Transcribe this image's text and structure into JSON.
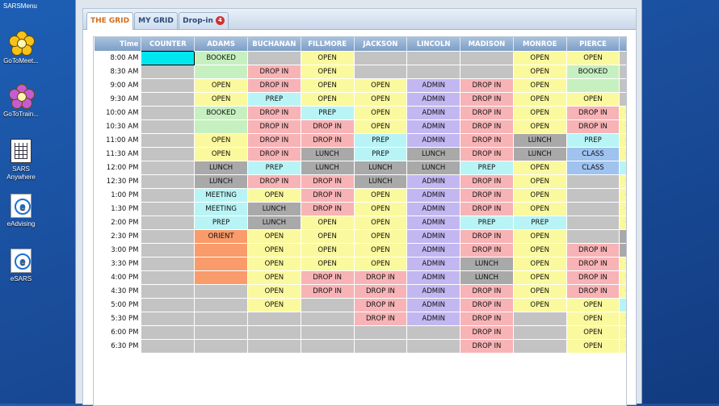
{
  "desktop": {
    "top_label": "SARSMenu",
    "icons": [
      "GoToMeet...",
      "GoToTrain...",
      "SARS Anywhere",
      "eAdvising",
      "eSARS"
    ]
  },
  "tabs": [
    {
      "label": "THE GRID",
      "active": true
    },
    {
      "label": "MY GRID",
      "active": false
    },
    {
      "label": "Drop-in",
      "active": false,
      "badge": "4"
    }
  ],
  "grid": {
    "headers": [
      "Time",
      "COUNTER",
      "ADAMS",
      "BUCHANAN",
      "FILLMORE",
      "JACKSON",
      "LINCOLN",
      "MADISON",
      "MONROE",
      "PIERCE",
      "POLI"
    ],
    "rows": [
      {
        "time": "8:00 AM",
        "cells": [
          [
            "",
            "cy"
          ],
          [
            "BOOKED",
            "gr"
          ],
          [
            "",
            "g"
          ],
          [
            "OPEN",
            "y"
          ],
          [
            "",
            "g"
          ],
          [
            "",
            "g"
          ],
          [
            "",
            "g"
          ],
          [
            "OPEN",
            "y"
          ],
          [
            "OPEN",
            "y"
          ],
          [
            "",
            "g"
          ]
        ]
      },
      {
        "time": "8:30 AM",
        "cells": [
          [
            "",
            "g"
          ],
          [
            "",
            "gr"
          ],
          [
            "DROP IN",
            "r"
          ],
          [
            "OPEN",
            "y"
          ],
          [
            "",
            "g"
          ],
          [
            "",
            "g"
          ],
          [
            "",
            "g"
          ],
          [
            "OPEN",
            "y"
          ],
          [
            "BOOKED",
            "gr"
          ],
          [
            "",
            "g"
          ]
        ]
      },
      {
        "time": "9:00 AM",
        "cells": [
          [
            "",
            "g"
          ],
          [
            "OPEN",
            "y"
          ],
          [
            "DROP IN",
            "r"
          ],
          [
            "OPEN",
            "y"
          ],
          [
            "OPEN",
            "y"
          ],
          [
            "ADMIN",
            "p"
          ],
          [
            "DROP IN",
            "r"
          ],
          [
            "OPEN",
            "y"
          ],
          [
            "",
            "gr"
          ],
          [
            "",
            "g"
          ]
        ]
      },
      {
        "time": "9:30 AM",
        "cells": [
          [
            "",
            "g"
          ],
          [
            "OPEN",
            "y"
          ],
          [
            "PREP",
            "b"
          ],
          [
            "OPEN",
            "y"
          ],
          [
            "OPEN",
            "y"
          ],
          [
            "ADMIN",
            "p"
          ],
          [
            "DROP IN",
            "r"
          ],
          [
            "OPEN",
            "y"
          ],
          [
            "OPEN",
            "y"
          ],
          [
            "",
            "g"
          ]
        ]
      },
      {
        "time": "10:00 AM",
        "cells": [
          [
            "",
            "g"
          ],
          [
            "BOOKED",
            "gr"
          ],
          [
            "DROP IN",
            "r"
          ],
          [
            "PREP",
            "b"
          ],
          [
            "OPEN",
            "y"
          ],
          [
            "ADMIN",
            "p"
          ],
          [
            "DROP IN",
            "r"
          ],
          [
            "OPEN",
            "y"
          ],
          [
            "DROP IN",
            "r"
          ],
          [
            "OPEN",
            "y"
          ]
        ]
      },
      {
        "time": "10:30 AM",
        "cells": [
          [
            "",
            "g"
          ],
          [
            "",
            "gr"
          ],
          [
            "DROP IN",
            "r"
          ],
          [
            "DROP IN",
            "r"
          ],
          [
            "OPEN",
            "y"
          ],
          [
            "ADMIN",
            "p"
          ],
          [
            "DROP IN",
            "r"
          ],
          [
            "OPEN",
            "y"
          ],
          [
            "DROP IN",
            "r"
          ],
          [
            "OPEN",
            "y"
          ]
        ]
      },
      {
        "time": "11:00 AM",
        "cells": [
          [
            "",
            "g"
          ],
          [
            "OPEN",
            "y"
          ],
          [
            "DROP IN",
            "r"
          ],
          [
            "DROP IN",
            "r"
          ],
          [
            "PREP",
            "b"
          ],
          [
            "ADMIN",
            "p"
          ],
          [
            "DROP IN",
            "r"
          ],
          [
            "LUNCH",
            "dk"
          ],
          [
            "PREP",
            "b"
          ],
          [
            "OPEN",
            "y"
          ]
        ]
      },
      {
        "time": "11:30 AM",
        "cells": [
          [
            "",
            "g"
          ],
          [
            "OPEN",
            "y"
          ],
          [
            "DROP IN",
            "r"
          ],
          [
            "LUNCH",
            "dk"
          ],
          [
            "PREP",
            "b"
          ],
          [
            "LUNCH",
            "dk"
          ],
          [
            "DROP IN",
            "r"
          ],
          [
            "LUNCH",
            "dk"
          ],
          [
            "CLASS",
            "cb"
          ],
          [
            "OPEN",
            "y"
          ]
        ]
      },
      {
        "time": "12:00 PM",
        "cells": [
          [
            "",
            "g"
          ],
          [
            "LUNCH",
            "dk"
          ],
          [
            "PREP",
            "b"
          ],
          [
            "LUNCH",
            "dk"
          ],
          [
            "LUNCH",
            "dk"
          ],
          [
            "LUNCH",
            "dk"
          ],
          [
            "PREP",
            "b"
          ],
          [
            "OPEN",
            "y"
          ],
          [
            "CLASS",
            "cb"
          ],
          [
            "PREP",
            "b"
          ]
        ]
      },
      {
        "time": "12:30 PM",
        "cells": [
          [
            "",
            "g"
          ],
          [
            "LUNCH",
            "dk"
          ],
          [
            "DROP IN",
            "r"
          ],
          [
            "DROP IN",
            "r"
          ],
          [
            "LUNCH",
            "dk"
          ],
          [
            "ADMIN",
            "p"
          ],
          [
            "DROP IN",
            "r"
          ],
          [
            "OPEN",
            "y"
          ],
          [
            "",
            "g"
          ],
          [
            "OPEN",
            "y"
          ]
        ]
      },
      {
        "time": "1:00 PM",
        "cells": [
          [
            "",
            "g"
          ],
          [
            "MEETING",
            "b"
          ],
          [
            "OPEN",
            "y"
          ],
          [
            "DROP IN",
            "r"
          ],
          [
            "OPEN",
            "y"
          ],
          [
            "ADMIN",
            "p"
          ],
          [
            "DROP IN",
            "r"
          ],
          [
            "OPEN",
            "y"
          ],
          [
            "",
            "g"
          ],
          [
            "OPEN",
            "y"
          ]
        ]
      },
      {
        "time": "1:30 PM",
        "cells": [
          [
            "",
            "g"
          ],
          [
            "MEETING",
            "b"
          ],
          [
            "LUNCH",
            "dk"
          ],
          [
            "DROP IN",
            "r"
          ],
          [
            "OPEN",
            "y"
          ],
          [
            "ADMIN",
            "p"
          ],
          [
            "DROP IN",
            "r"
          ],
          [
            "OPEN",
            "y"
          ],
          [
            "",
            "g"
          ],
          [
            "OPEN",
            "y"
          ]
        ]
      },
      {
        "time": "2:00 PM",
        "cells": [
          [
            "",
            "g"
          ],
          [
            "PREP",
            "b"
          ],
          [
            "LUNCH",
            "dk"
          ],
          [
            "OPEN",
            "y"
          ],
          [
            "OPEN",
            "y"
          ],
          [
            "ADMIN",
            "p"
          ],
          [
            "PREP",
            "b"
          ],
          [
            "PREP",
            "b"
          ],
          [
            "",
            "g"
          ],
          [
            "OPEN",
            "y"
          ]
        ]
      },
      {
        "time": "2:30 PM",
        "cells": [
          [
            "",
            "g"
          ],
          [
            "ORIENT",
            "o"
          ],
          [
            "OPEN",
            "y"
          ],
          [
            "OPEN",
            "y"
          ],
          [
            "OPEN",
            "y"
          ],
          [
            "ADMIN",
            "p"
          ],
          [
            "DROP IN",
            "r"
          ],
          [
            "OPEN",
            "y"
          ],
          [
            "",
            "g"
          ],
          [
            "LUNC",
            "dk"
          ]
        ]
      },
      {
        "time": "3:00 PM",
        "cells": [
          [
            "",
            "g"
          ],
          [
            "",
            "o"
          ],
          [
            "OPEN",
            "y"
          ],
          [
            "OPEN",
            "y"
          ],
          [
            "OPEN",
            "y"
          ],
          [
            "ADMIN",
            "p"
          ],
          [
            "DROP IN",
            "r"
          ],
          [
            "OPEN",
            "y"
          ],
          [
            "DROP IN",
            "r"
          ],
          [
            "LUNC",
            "dk"
          ]
        ]
      },
      {
        "time": "3:30 PM",
        "cells": [
          [
            "",
            "g"
          ],
          [
            "",
            "o"
          ],
          [
            "OPEN",
            "y"
          ],
          [
            "OPEN",
            "y"
          ],
          [
            "OPEN",
            "y"
          ],
          [
            "ADMIN",
            "p"
          ],
          [
            "LUNCH",
            "dk"
          ],
          [
            "OPEN",
            "y"
          ],
          [
            "DROP IN",
            "r"
          ],
          [
            "OPEN",
            "y"
          ]
        ]
      },
      {
        "time": "4:00 PM",
        "cells": [
          [
            "",
            "g"
          ],
          [
            "",
            "o"
          ],
          [
            "OPEN",
            "y"
          ],
          [
            "DROP IN",
            "r"
          ],
          [
            "DROP IN",
            "r"
          ],
          [
            "ADMIN",
            "p"
          ],
          [
            "LUNCH",
            "dk"
          ],
          [
            "OPEN",
            "y"
          ],
          [
            "DROP IN",
            "r"
          ],
          [
            "OPEN",
            "y"
          ]
        ]
      },
      {
        "time": "4:30 PM",
        "cells": [
          [
            "",
            "g"
          ],
          [
            "",
            "g"
          ],
          [
            "OPEN",
            "y"
          ],
          [
            "DROP IN",
            "r"
          ],
          [
            "DROP IN",
            "r"
          ],
          [
            "ADMIN",
            "p"
          ],
          [
            "DROP IN",
            "r"
          ],
          [
            "OPEN",
            "y"
          ],
          [
            "DROP IN",
            "r"
          ],
          [
            "OPEN",
            "y"
          ]
        ]
      },
      {
        "time": "5:00 PM",
        "cells": [
          [
            "",
            "g"
          ],
          [
            "",
            "g"
          ],
          [
            "OPEN",
            "y"
          ],
          [
            "",
            "g"
          ],
          [
            "DROP IN",
            "r"
          ],
          [
            "ADMIN",
            "p"
          ],
          [
            "DROP IN",
            "r"
          ],
          [
            "OPEN",
            "y"
          ],
          [
            "OPEN",
            "y"
          ],
          [
            "PREP",
            "b"
          ]
        ]
      },
      {
        "time": "5:30 PM",
        "cells": [
          [
            "",
            "g"
          ],
          [
            "",
            "g"
          ],
          [
            "",
            "g"
          ],
          [
            "",
            "g"
          ],
          [
            "DROP IN",
            "r"
          ],
          [
            "ADMIN",
            "p"
          ],
          [
            "DROP IN",
            "r"
          ],
          [
            "",
            "g"
          ],
          [
            "OPEN",
            "y"
          ],
          [
            "OPEN",
            "y"
          ]
        ]
      },
      {
        "time": "6:00 PM",
        "cells": [
          [
            "",
            "g"
          ],
          [
            "",
            "g"
          ],
          [
            "",
            "g"
          ],
          [
            "",
            "g"
          ],
          [
            "",
            "g"
          ],
          [
            "",
            "g"
          ],
          [
            "DROP IN",
            "r"
          ],
          [
            "",
            "g"
          ],
          [
            "OPEN",
            "y"
          ],
          [
            "OPEN",
            "y"
          ]
        ]
      },
      {
        "time": "6:30 PM",
        "cells": [
          [
            "",
            "g"
          ],
          [
            "",
            "g"
          ],
          [
            "",
            "g"
          ],
          [
            "",
            "g"
          ],
          [
            "",
            "g"
          ],
          [
            "",
            "g"
          ],
          [
            "DROP IN",
            "r"
          ],
          [
            "",
            "g"
          ],
          [
            "OPEN",
            "y"
          ],
          [
            "OPEN",
            "y"
          ]
        ]
      }
    ]
  }
}
